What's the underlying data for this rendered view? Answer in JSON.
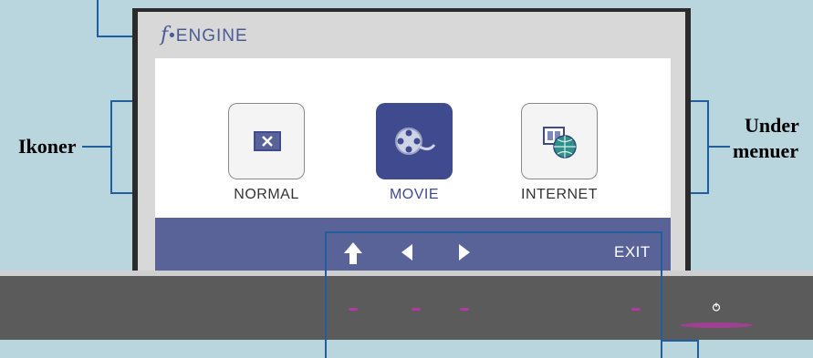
{
  "osd": {
    "brand_glyph": "f",
    "brand_text": "•ENGINE",
    "modes": [
      {
        "label": "NORMAL",
        "icon": "normal-mode-icon",
        "selected": false
      },
      {
        "label": "MOVIE",
        "icon": "movie-mode-icon",
        "selected": true
      },
      {
        "label": "INTERNET",
        "icon": "internet-mode-icon",
        "selected": false
      }
    ],
    "nav": {
      "exit_label": "EXIT"
    }
  },
  "callouts": {
    "icons_label": "Ikoner",
    "submenus_line1": "Under",
    "submenus_line2": "menuer"
  },
  "colors": {
    "accent": "#3f4b8e",
    "bar": "#5a6398",
    "callout_line": "#1f5f9e",
    "background": "#b9d6df"
  }
}
